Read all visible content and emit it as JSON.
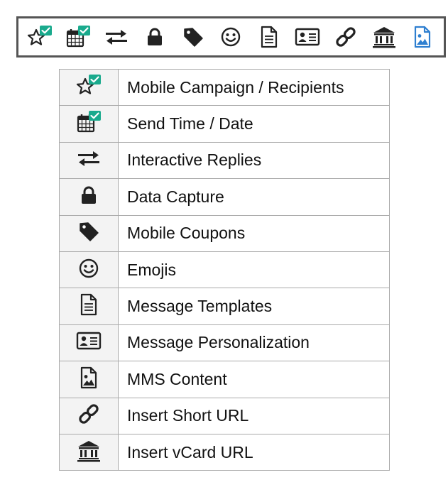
{
  "colors": {
    "accent": "#1aaa8d",
    "icon": "#222222",
    "mms": "#2e7fd0",
    "border": "#555555"
  },
  "toolbar": {
    "buttons": [
      {
        "name": "star-check-icon"
      },
      {
        "name": "calendar-check-icon"
      },
      {
        "name": "arrows-exchange-icon"
      },
      {
        "name": "lock-icon"
      },
      {
        "name": "tag-icon"
      },
      {
        "name": "smiley-icon"
      },
      {
        "name": "document-icon"
      },
      {
        "name": "id-card-icon"
      },
      {
        "name": "link-icon"
      },
      {
        "name": "bank-icon"
      },
      {
        "name": "image-file-icon"
      }
    ]
  },
  "legend": {
    "rows": [
      {
        "icon": "star-check-icon",
        "label": "Mobile Campaign / Recipients"
      },
      {
        "icon": "calendar-check-icon",
        "label": "Send Time / Date"
      },
      {
        "icon": "arrows-exchange-icon",
        "label": "Interactive Replies"
      },
      {
        "icon": "lock-icon",
        "label": "Data Capture"
      },
      {
        "icon": "tag-icon",
        "label": "Mobile Coupons"
      },
      {
        "icon": "smiley-icon",
        "label": "Emojis"
      },
      {
        "icon": "document-icon",
        "label": "Message Templates"
      },
      {
        "icon": "id-card-icon",
        "label": "Message Personalization"
      },
      {
        "icon": "image-file-icon",
        "label": "MMS Content"
      },
      {
        "icon": "link-icon",
        "label": "Insert Short URL"
      },
      {
        "icon": "bank-icon",
        "label": "Insert vCard URL"
      }
    ]
  }
}
